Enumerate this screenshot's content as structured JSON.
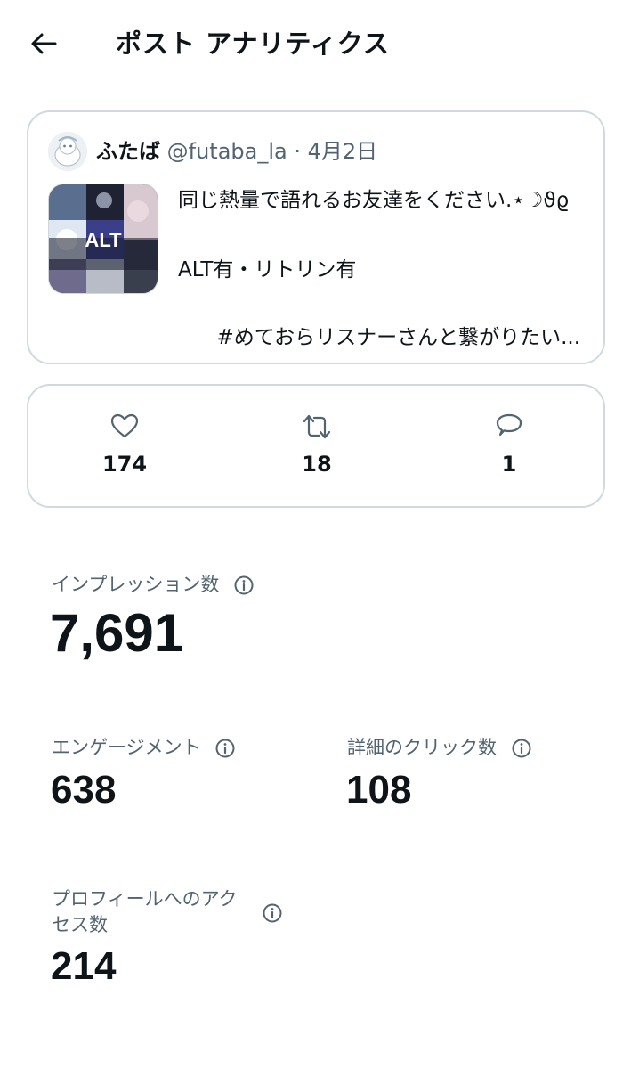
{
  "header": {
    "title": "ポスト アナリティクス",
    "back_icon": "arrow-left-icon"
  },
  "post": {
    "author_name": "ふたば",
    "author_handle": "@futaba_la",
    "separator": " · ",
    "date": "4月2日",
    "thumbnail_badge": "ALT",
    "text_line1": "同じ熱量で語れるお友達をください.⋆☽ϑϱ",
    "text_line2": "ALT有・リトリン有",
    "text_line3": "#めておらリスナーさんと繋がりたい..."
  },
  "stats": {
    "likes": "174",
    "reposts": "18",
    "replies": "1"
  },
  "metrics": {
    "impressions_label": "インプレッション数",
    "impressions_value": "7,691",
    "engagement_label": "エンゲージメント",
    "engagement_value": "638",
    "detail_clicks_label": "詳細のクリック数",
    "detail_clicks_value": "108",
    "profile_visits_label_line1": "プロフィールへのアク",
    "profile_visits_label_line2": "セス数",
    "profile_visits_value": "214"
  },
  "colors": {
    "text": "#0f1419",
    "muted": "#536471",
    "border": "#cfd9de"
  }
}
